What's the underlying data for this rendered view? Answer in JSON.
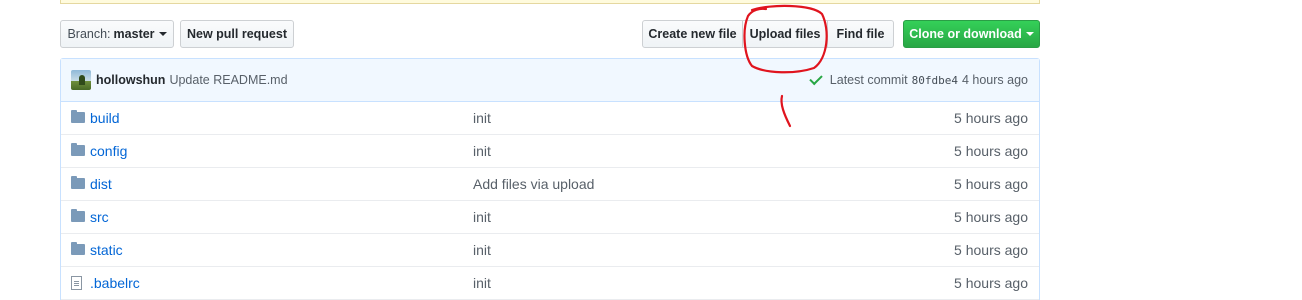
{
  "toolbar": {
    "branch_prefix": "Branch:",
    "branch_name": "master",
    "new_pr_label": "New pull request",
    "create_file_label": "Create new file",
    "upload_files_label": "Upload files",
    "find_file_label": "Find file",
    "clone_label": "Clone or download"
  },
  "commit": {
    "author": "hollowshun",
    "message": "Update README.md",
    "latest_label": "Latest commit",
    "sha": "80fdbe4",
    "age": "4 hours ago"
  },
  "files": [
    {
      "type": "folder",
      "name": "build",
      "message": "init",
      "age": "5 hours ago"
    },
    {
      "type": "folder",
      "name": "config",
      "message": "init",
      "age": "5 hours ago"
    },
    {
      "type": "folder",
      "name": "dist",
      "message": "Add files via upload",
      "age": "5 hours ago"
    },
    {
      "type": "folder",
      "name": "src",
      "message": "init",
      "age": "5 hours ago"
    },
    {
      "type": "folder",
      "name": "static",
      "message": "init",
      "age": "5 hours ago"
    },
    {
      "type": "file",
      "name": ".babelrc",
      "message": "init",
      "age": "5 hours ago"
    }
  ],
  "colors": {
    "link": "#0366d6",
    "clone_button": "#28a745",
    "annotation": "#e0141e"
  }
}
